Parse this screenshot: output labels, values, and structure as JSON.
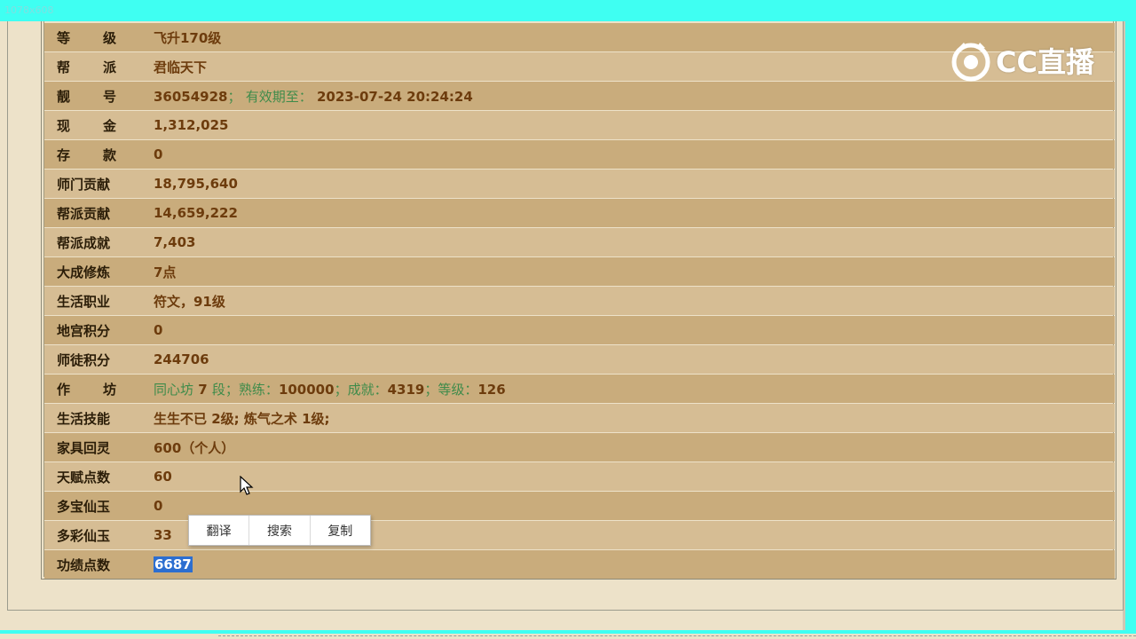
{
  "window": {
    "dimensions_label": "1078x608"
  },
  "logo": {
    "text": "CC直播"
  },
  "rows": [
    {
      "label_a": "等",
      "label_b": "级",
      "value": "飞升170级"
    },
    {
      "label_a": "帮",
      "label_b": "派",
      "value": "君临天下"
    },
    {
      "label_a": "靓",
      "label_b": "号",
      "value_num": "36054928",
      "value_sep": "；",
      "value_mid": "有效期至：",
      "value_date": "2023-07-24 20:24:24"
    },
    {
      "label_a": "现",
      "label_b": "金",
      "value": "1,312,025"
    },
    {
      "label_a": "存",
      "label_b": "款",
      "value": "0"
    },
    {
      "label": "师门贡献",
      "value": "18,795,640"
    },
    {
      "label": "帮派贡献",
      "value": "14,659,222"
    },
    {
      "label": "帮派成就",
      "value": "7,403"
    },
    {
      "label": "大成修炼",
      "value": "7点"
    },
    {
      "label": "生活职业",
      "value": "符文，91级"
    },
    {
      "label": "地宫积分",
      "value": "0"
    },
    {
      "label": "师徒积分",
      "value": "244706"
    },
    {
      "label_a": "作",
      "label_b": "坊",
      "v1": "同心坊",
      "v2": "7",
      "v3": "段；熟练：",
      "v4": "100000",
      "v5": "；成就：",
      "v6": "4319",
      "v7": "；等级：",
      "v8": "126"
    },
    {
      "label": "生活技能",
      "value": "生生不已 2级; 炼气之术 1级;"
    },
    {
      "label": "家具回灵",
      "value": "600（个人）"
    },
    {
      "label": "天赋点数",
      "value": "60"
    },
    {
      "label": "多宝仙玉",
      "value": "0"
    },
    {
      "label": "多彩仙玉",
      "value": "33"
    },
    {
      "label": "功绩点数",
      "value": "6687"
    }
  ],
  "context_menu": {
    "items": [
      "翻译",
      "搜索",
      "复制"
    ]
  }
}
